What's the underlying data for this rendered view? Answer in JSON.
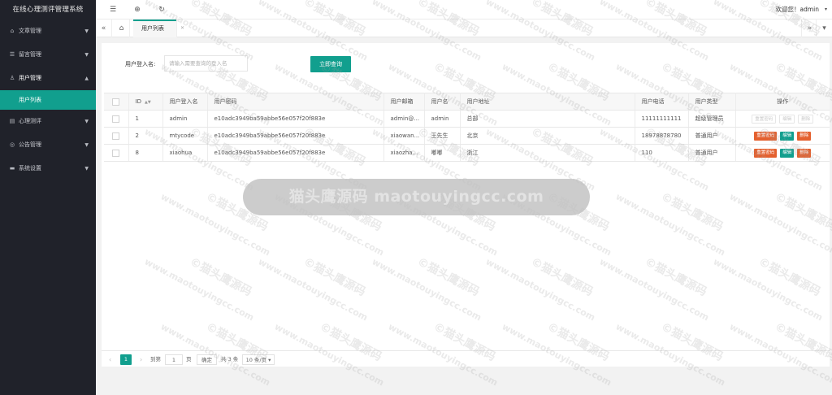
{
  "app": {
    "title": "在线心理测评管理系统"
  },
  "sidebar": {
    "items": [
      {
        "icon": "book-icon",
        "glyph": "⌂",
        "label": "文章管理",
        "expanded": false
      },
      {
        "icon": "message-icon",
        "glyph": "☰",
        "label": "留言管理",
        "expanded": false
      },
      {
        "icon": "user-icon",
        "glyph": "♙",
        "label": "用户管理",
        "expanded": true,
        "children": [
          {
            "label": "用户列表",
            "active": true
          }
        ]
      },
      {
        "icon": "test-icon",
        "glyph": "▤",
        "label": "心理测评",
        "expanded": false
      },
      {
        "icon": "notice-icon",
        "glyph": "◎",
        "label": "公告管理",
        "expanded": false
      },
      {
        "icon": "settings-icon",
        "glyph": "▬",
        "label": "系统设置",
        "expanded": false
      }
    ]
  },
  "header": {
    "welcome": "欢迎您！admin"
  },
  "tabs": [
    {
      "label": "用户列表"
    }
  ],
  "search": {
    "label": "用户登入名:",
    "placeholder": "请输入需要查询的登入名",
    "button": "立即查询"
  },
  "table": {
    "columns": [
      "ID",
      "用户登入名",
      "用户密码",
      "用户邮箱",
      "用户名",
      "用户地址",
      "用户电话",
      "用户类型",
      "操作"
    ],
    "rows": [
      {
        "id": "1",
        "login": "admin",
        "password": "e10adc3949ba59abbe56e057f20f883e",
        "email": "admin@...",
        "name": "admin",
        "address": "总部",
        "phone": "11111111111",
        "type": "超级管理员",
        "ops_enabled": false
      },
      {
        "id": "2",
        "login": "mtycode",
        "password": "e10adc3949ba59abbe56e057f20f883e",
        "email": "xiaowan...",
        "name": "王先生",
        "address": "北京",
        "phone": "18978878780",
        "type": "普通用户",
        "ops_enabled": true
      },
      {
        "id": "8",
        "login": "xiaohua",
        "password": "e10adc3949ba59abbe56e057f20f883e",
        "email": "xiaozha...",
        "name": "嘟嘟",
        "address": "浙江",
        "phone": "110",
        "type": "普通用户",
        "ops_enabled": true
      }
    ],
    "ops": {
      "reset": "重置密码",
      "edit": "编辑",
      "delete": "删除"
    }
  },
  "pager": {
    "current": "1",
    "goto_label": "到第",
    "goto_value": "1",
    "page_unit": "页",
    "confirm": "确定",
    "total": "共 3 条",
    "page_size": "10 条/页"
  },
  "watermark": {
    "banner": "猫头鹰源码 maotouyingcc.com",
    "url": "www.maotouyingcc.com",
    "brand": "©猫头鹰源码"
  },
  "colors": {
    "accent": "#119f8e",
    "danger": "#e4602e",
    "sidebar": "#20222a"
  }
}
